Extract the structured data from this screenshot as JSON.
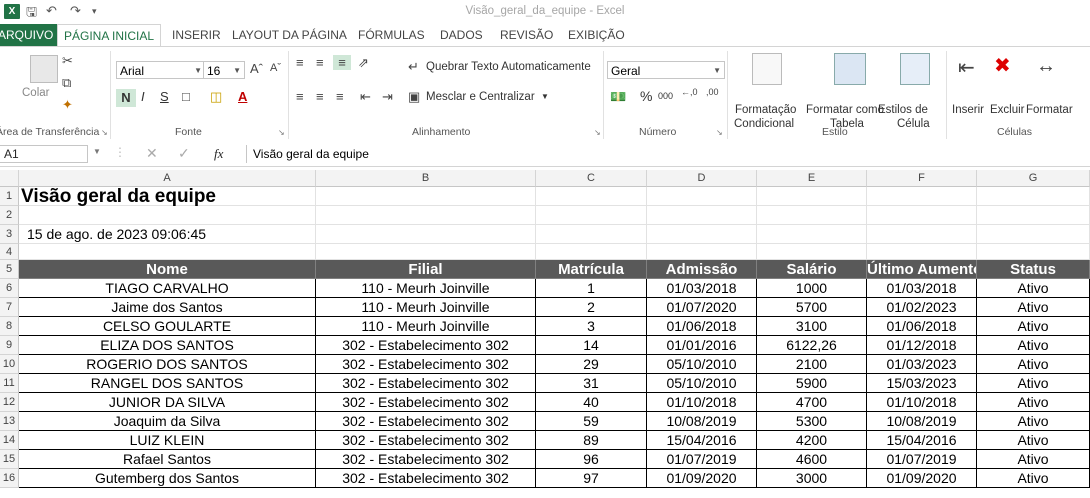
{
  "window": {
    "title": "Visão_geral_da_equipe - Excel",
    "logo": "X"
  },
  "quick_access": {
    "save_icon": "save-icon",
    "undo_icon": "undo-icon",
    "redo_icon": "redo-icon",
    "customize_icon": "customize-icon"
  },
  "tabs": [
    "ARQUIVO",
    "PÁGINA INICIAL",
    "INSERIR",
    "LAYOUT DA PÁGINA",
    "FÓRMULAS",
    "DADOS",
    "REVISÃO",
    "EXIBIÇÃO"
  ],
  "ribbon": {
    "clipboard": {
      "paste_label": "Colar",
      "group_label": "Área de Transferência"
    },
    "font": {
      "font_name": "Arial",
      "font_size": "16",
      "bold": "N",
      "italic": "I",
      "underline": "S",
      "group_label": "Fonte"
    },
    "alignment": {
      "wrap_text": "Quebrar Texto Automaticamente",
      "merge_center": "Mesclar e Centralizar",
      "group_label": "Alinhamento"
    },
    "number": {
      "format": "Geral",
      "percent": "%",
      "thousands": "000",
      "group_label": "Número"
    },
    "styles": {
      "conditional": "Formatação",
      "conditional2": "Condicional",
      "format_table": "Formatar como",
      "format_table2": "Tabela",
      "cell_styles": "Estilos de",
      "cell_styles2": "Célula",
      "group_label": "Estilo"
    },
    "cells": {
      "insert": "Inserir",
      "delete": "Excluir",
      "format": "Formatar",
      "group_label": "Células"
    }
  },
  "formula_bar": {
    "name_box": "A1",
    "fx": "fx",
    "content": "Visão geral da equipe"
  },
  "columns": [
    "A",
    "B",
    "C",
    "D",
    "E",
    "F",
    "G"
  ],
  "rows": [
    "1",
    "2",
    "3",
    "4",
    "5",
    "6",
    "7",
    "8",
    "9",
    "10",
    "11",
    "12",
    "13",
    "14",
    "15",
    "16"
  ],
  "sheet": {
    "title": "Visão geral da equipe",
    "timestamp": "15 de ago. de 2023 09:06:45",
    "headers": [
      "Nome",
      "Filial",
      "Matrícula",
      "Admissão",
      "Salário",
      "Último Aumento",
      "Status"
    ],
    "data": [
      [
        "TIAGO CARVALHO",
        "110 - Meurh Joinville",
        "1",
        "01/03/2018",
        "1000",
        "01/03/2018",
        "Ativo"
      ],
      [
        "Jaime dos Santos",
        "110 - Meurh Joinville",
        "2",
        "01/07/2020",
        "5700",
        "01/02/2023",
        "Ativo"
      ],
      [
        "CELSO GOULARTE",
        "110 - Meurh Joinville",
        "3",
        "01/06/2018",
        "3100",
        "01/06/2018",
        "Ativo"
      ],
      [
        "ELIZA DOS SANTOS",
        "302 - Estabelecimento 302",
        "14",
        "01/01/2016",
        "6122,26",
        "01/12/2018",
        "Ativo"
      ],
      [
        "ROGERIO DOS SANTOS",
        "302 - Estabelecimento 302",
        "29",
        "05/10/2010",
        "2100",
        "01/03/2023",
        "Ativo"
      ],
      [
        "RANGEL DOS SANTOS",
        "302 - Estabelecimento 302",
        "31",
        "05/10/2010",
        "5900",
        "15/03/2023",
        "Ativo"
      ],
      [
        "JUNIOR DA SILVA",
        "302 - Estabelecimento 302",
        "40",
        "01/10/2018",
        "4700",
        "01/10/2018",
        "Ativo"
      ],
      [
        "Joaquim da Silva",
        "302 - Estabelecimento 302",
        "59",
        "10/08/2019",
        "5300",
        "10/08/2019",
        "Ativo"
      ],
      [
        "LUIZ KLEIN",
        "302 - Estabelecimento 302",
        "89",
        "15/04/2016",
        "4200",
        "15/04/2016",
        "Ativo"
      ],
      [
        "Rafael Santos",
        "302 - Estabelecimento 302",
        "96",
        "01/07/2019",
        "4600",
        "01/07/2019",
        "Ativo"
      ],
      [
        "Gutemberg dos Santos",
        "302 - Estabelecimento 302",
        "97",
        "01/09/2020",
        "3000",
        "01/09/2020",
        "Ativo"
      ]
    ]
  }
}
